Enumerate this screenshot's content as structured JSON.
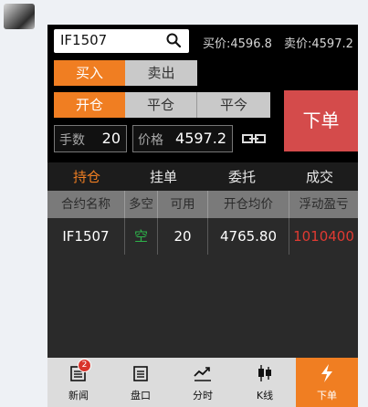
{
  "chat": {
    "avatar": "user-avatar"
  },
  "header": {
    "contract_code": "IF1507",
    "search_icon": "search-icon",
    "buy_quote_label": "买价:4596.8",
    "sell_quote_label": "卖价:4597.2"
  },
  "direction": {
    "buy_label": "买入",
    "sell_label": "卖出",
    "selected": "buy"
  },
  "offset": {
    "open_label": "开仓",
    "close_label": "平仓",
    "close_today_label": "平今",
    "selected": "open"
  },
  "order_button_label": "下单",
  "quantity": {
    "label": "手数",
    "value": "20"
  },
  "price": {
    "label": "价格",
    "value": "4597.2"
  },
  "tabs": [
    {
      "label": "持仓",
      "active": true
    },
    {
      "label": "挂单",
      "active": false
    },
    {
      "label": "委托",
      "active": false
    },
    {
      "label": "成交",
      "active": false
    }
  ],
  "table": {
    "headers": [
      "合约名称",
      "多空",
      "可用",
      "开仓均价",
      "浮动盈亏"
    ],
    "rows": [
      {
        "contract": "IF1507",
        "side": "空",
        "available": "20",
        "avg_price": "4765.80",
        "pnl": "1010400"
      }
    ],
    "colors": {
      "side": "#2db34a",
      "pnl": "#e03a32"
    }
  },
  "bottom_nav": [
    {
      "label": "新闻",
      "icon": "news-icon",
      "badge": "2"
    },
    {
      "label": "盘口",
      "icon": "order-book-icon"
    },
    {
      "label": "分时",
      "icon": "timeshare-chart-icon"
    },
    {
      "label": "K线",
      "icon": "candlestick-icon"
    },
    {
      "label": "下单",
      "icon": "lightning-icon",
      "active": true
    }
  ],
  "colors": {
    "accent": "#f07e22",
    "order": "#d44b4b"
  }
}
